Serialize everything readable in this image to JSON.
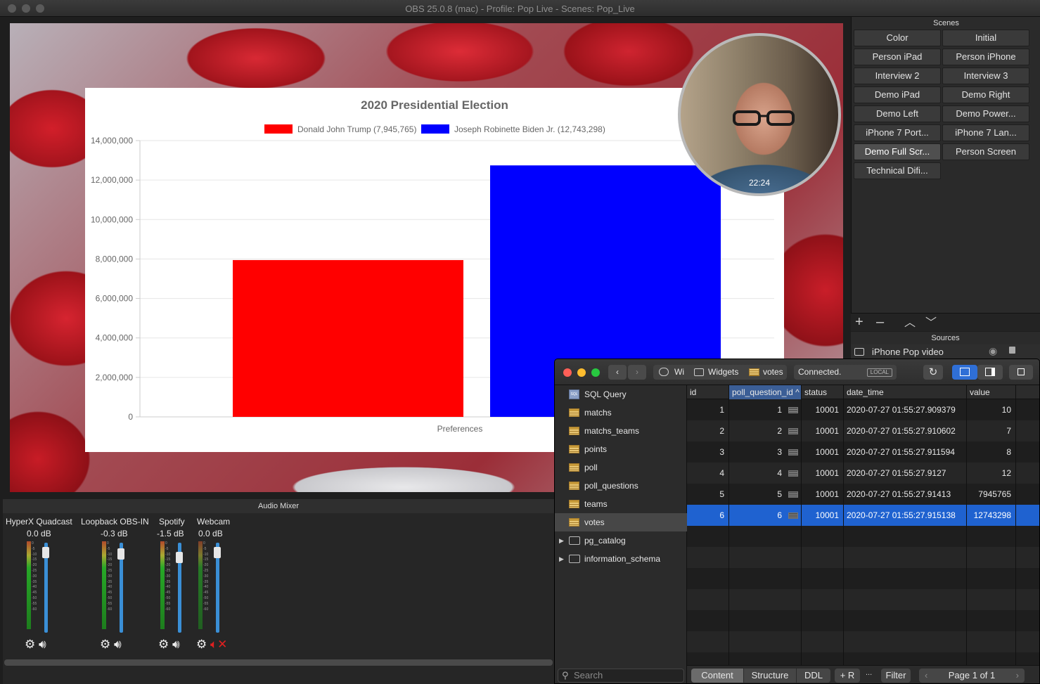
{
  "window": {
    "title": "OBS 25.0.8 (mac) - Profile: Pop Live - Scenes: Pop_Live"
  },
  "chart_data": {
    "type": "bar",
    "title": "2020 Presidential Election",
    "categories": [
      "Preferences"
    ],
    "xlabel": "Preferences",
    "ylabel": "",
    "ylim": [
      0,
      14000000
    ],
    "yticks": [
      "14,000,000",
      "12,000,000",
      "10,000,000",
      "8,000,000",
      "6,000,000",
      "4,000,000",
      "2,000,000",
      "0"
    ],
    "legend_position": "top",
    "grid": true,
    "series": [
      {
        "name": "Donald John Trump (7,945,765)",
        "values": [
          7945765
        ],
        "color": "#ff0000"
      },
      {
        "name": "Joseph Robinette Biden Jr. (12,743,298)",
        "values": [
          12743298
        ],
        "color": "#0000ff"
      }
    ]
  },
  "webcam": {
    "clock": "22:24"
  },
  "scenes": {
    "title": "Scenes",
    "items": [
      {
        "label": "Color",
        "active": false
      },
      {
        "label": "Initial",
        "active": false
      },
      {
        "label": "Person iPad",
        "active": false
      },
      {
        "label": "Person iPhone",
        "active": false
      },
      {
        "label": "Interview 2",
        "active": false
      },
      {
        "label": "Interview 3",
        "active": false
      },
      {
        "label": "Demo iPad",
        "active": false
      },
      {
        "label": "Demo Right",
        "active": false
      },
      {
        "label": "Demo Left",
        "active": false
      },
      {
        "label": "Demo Power...",
        "active": false
      },
      {
        "label": "iPhone 7 Port...",
        "active": false
      },
      {
        "label": "iPhone 7 Lan...",
        "active": false
      },
      {
        "label": "Demo Full Scr...",
        "active": true
      },
      {
        "label": "Person Screen",
        "active": false
      },
      {
        "label": "Technical Difi...",
        "active": false
      }
    ],
    "toolbar": {
      "add": "+",
      "remove": "–",
      "up": "︿",
      "down": "﹀"
    }
  },
  "sources": {
    "title": "Sources",
    "items": [
      {
        "label": "iPhone Pop video"
      }
    ]
  },
  "mixer": {
    "title": "Audio Mixer",
    "channels": [
      {
        "name": "HyperX Quadcast",
        "db": "0.0 dB",
        "level": 0.95,
        "muted": false
      },
      {
        "name": "Loopback OBS-IN",
        "db": "-0.3 dB",
        "level": 0.93,
        "muted": false
      },
      {
        "name": "Spotify",
        "db": "-1.5 dB",
        "level": 0.88,
        "muted": false
      },
      {
        "name": "Webcam",
        "db": "0.0 dB",
        "level": 0.95,
        "muted": true
      }
    ],
    "meter_ticks": [
      "0",
      "-5",
      "-10",
      "-15",
      "-20",
      "-25",
      "-30",
      "-35",
      "-40",
      "-45",
      "-50",
      "-55",
      "-60"
    ]
  },
  "db": {
    "breadcrumbs": {
      "db": "Wi",
      "schema": "Widgets",
      "table": "votes"
    },
    "status": "Connected.",
    "badge": "LOCAL",
    "sidebar": [
      {
        "label": "SQL Query",
        "kind": "sql"
      },
      {
        "label": "matchs",
        "kind": "table"
      },
      {
        "label": "matchs_teams",
        "kind": "table"
      },
      {
        "label": "points",
        "kind": "table"
      },
      {
        "label": "poll",
        "kind": "table"
      },
      {
        "label": "poll_questions",
        "kind": "table"
      },
      {
        "label": "teams",
        "kind": "table"
      },
      {
        "label": "votes",
        "kind": "table",
        "selected": true
      },
      {
        "label": "pg_catalog",
        "kind": "folder"
      },
      {
        "label": "information_schema",
        "kind": "folder"
      }
    ],
    "search_placeholder": "Search",
    "columns": [
      "id",
      "poll_question_id ^",
      "status",
      "date_time",
      "value"
    ],
    "rows": [
      [
        "1",
        "1",
        "10001",
        "2020-07-27 01:55:27.909379",
        "10"
      ],
      [
        "2",
        "2",
        "10001",
        "2020-07-27 01:55:27.910602",
        "7"
      ],
      [
        "3",
        "3",
        "10001",
        "2020-07-27 01:55:27.911594",
        "8"
      ],
      [
        "4",
        "4",
        "10001",
        "2020-07-27 01:55:27.9127",
        "12"
      ],
      [
        "5",
        "5",
        "10001",
        "2020-07-27 01:55:27.91413",
        "7945765"
      ],
      [
        "6",
        "6",
        "10001",
        "2020-07-27 01:55:27.915138",
        "12743298"
      ]
    ],
    "selected_row": 5,
    "tabs": [
      "Content",
      "Structure",
      "DDL"
    ],
    "add_row": "+ R",
    "more": "...",
    "filter": "Filter",
    "page": "Page 1 of 1"
  }
}
